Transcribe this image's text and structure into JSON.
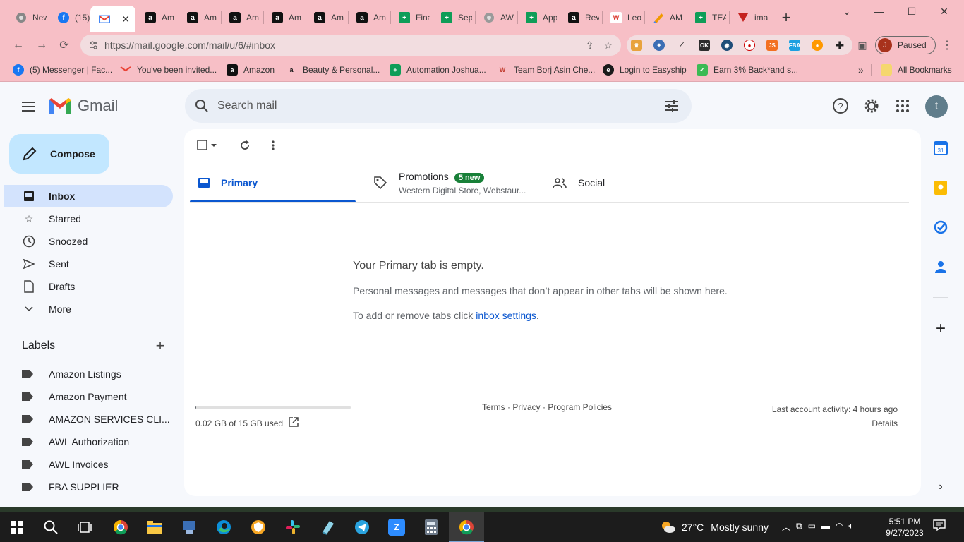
{
  "browser": {
    "tabs": [
      {
        "label": "New",
        "icon": "chrome-icon",
        "color": "#777777"
      },
      {
        "label": "(15)",
        "icon": "facebook-icon",
        "color": "#1877f2"
      },
      {
        "label": "",
        "icon": "gmail-icon",
        "color": "#ea4335",
        "active": true
      },
      {
        "label": "Am",
        "icon": "amazon-icon",
        "color": "#111111"
      },
      {
        "label": "Am",
        "icon": "amazon-icon",
        "color": "#111111"
      },
      {
        "label": "Am",
        "icon": "amazon-icon",
        "color": "#111111"
      },
      {
        "label": "Am",
        "icon": "amazon-icon",
        "color": "#111111"
      },
      {
        "label": "Am",
        "icon": "amazon-icon",
        "color": "#111111"
      },
      {
        "label": "Am",
        "icon": "amazon-icon",
        "color": "#111111"
      },
      {
        "label": "Fina",
        "icon": "sheets-icon",
        "color": "#0f9d58"
      },
      {
        "label": "Sep",
        "icon": "sheets-icon",
        "color": "#0f9d58"
      },
      {
        "label": "AW",
        "icon": "globe-icon",
        "color": "#777777"
      },
      {
        "label": "App",
        "icon": "sheets-icon",
        "color": "#0f9d58"
      },
      {
        "label": "Rev",
        "icon": "amazon-icon",
        "color": "#111111"
      },
      {
        "label": "Leo",
        "icon": "leo-icon",
        "color": "#d93025"
      },
      {
        "label": "AM",
        "icon": "pen-icon",
        "color": "#f29900"
      },
      {
        "label": "TEA",
        "icon": "sheets-icon",
        "color": "#0f9d58"
      },
      {
        "label": "ima",
        "icon": "image-icon",
        "color": "#c5221f"
      }
    ],
    "url": "https://mail.google.com/mail/u/6/#inbox",
    "profile_initial": "J",
    "profile_status": "Paused",
    "bookmarks": [
      {
        "label": "(5) Messenger | Fac...",
        "icon": "facebook-icon",
        "color": "#1877f2"
      },
      {
        "label": "You've been invited...",
        "icon": "gmail-icon",
        "color": "#ea4335"
      },
      {
        "label": "Amazon",
        "icon": "amazon-icon",
        "color": "#111111"
      },
      {
        "label": "Beauty & Personal...",
        "icon": "amazon-a-icon",
        "color": "#ffffff"
      },
      {
        "label": "Automation Joshua...",
        "icon": "sheets-icon",
        "color": "#0f9d58"
      },
      {
        "label": "Team Borj Asin Che...",
        "icon": "borj-icon",
        "color": "#c0c0c0"
      },
      {
        "label": "Login to Easyship",
        "icon": "easyship-icon",
        "color": "#1a1a1a"
      },
      {
        "label": "Earn 3% Back*and s...",
        "icon": "cashback-icon",
        "color": "#3cba54"
      }
    ],
    "all_bookmarks": "All Bookmarks"
  },
  "gmail": {
    "brand": "Gmail",
    "search_placeholder": "Search mail",
    "avatar_initial": "t",
    "compose_label": "Compose",
    "nav": [
      {
        "label": "Inbox",
        "icon": "inbox-icon",
        "active": true
      },
      {
        "label": "Starred",
        "icon": "star-icon"
      },
      {
        "label": "Snoozed",
        "icon": "clock-icon"
      },
      {
        "label": "Sent",
        "icon": "send-icon"
      },
      {
        "label": "Drafts",
        "icon": "draft-icon"
      },
      {
        "label": "More",
        "icon": "chevron-down-icon"
      }
    ],
    "labels_title": "Labels",
    "labels": [
      "Amazon Listings",
      "Amazon Payment",
      "AMAZON SERVICES CLI...",
      "AWL Authorization",
      "AWL Invoices",
      "FBA SUPPLIER"
    ],
    "tabs": {
      "primary": "Primary",
      "promotions": "Promotions",
      "promotions_badge": "5 new",
      "promotions_sub": "Western Digital Store, Webstaur...",
      "social": "Social"
    },
    "empty": {
      "title": "Your Primary tab is empty.",
      "desc": "Personal messages and messages that don’t appear in other tabs will be shown here.",
      "hint_prefix": "To add or remove tabs click ",
      "hint_link": "inbox settings",
      "hint_suffix": "."
    },
    "storage": {
      "text": "0.02 GB of 15 GB used",
      "fraction": 0.0013
    },
    "footer": "Terms · Privacy · Program Policies",
    "activity": "Last account activity: 4 hours ago",
    "details": "Details"
  },
  "taskbar": {
    "weather_temp": "27°C",
    "weather_text": "Mostly sunny",
    "time": "5:51 PM",
    "date": "9/27/2023"
  },
  "colors": {
    "accent": "#0b57d0",
    "compose_bg": "#c2e7ff",
    "active_nav": "#d3e3fd",
    "chrome_frame": "#f7bfc6",
    "badge_green": "#188038"
  }
}
